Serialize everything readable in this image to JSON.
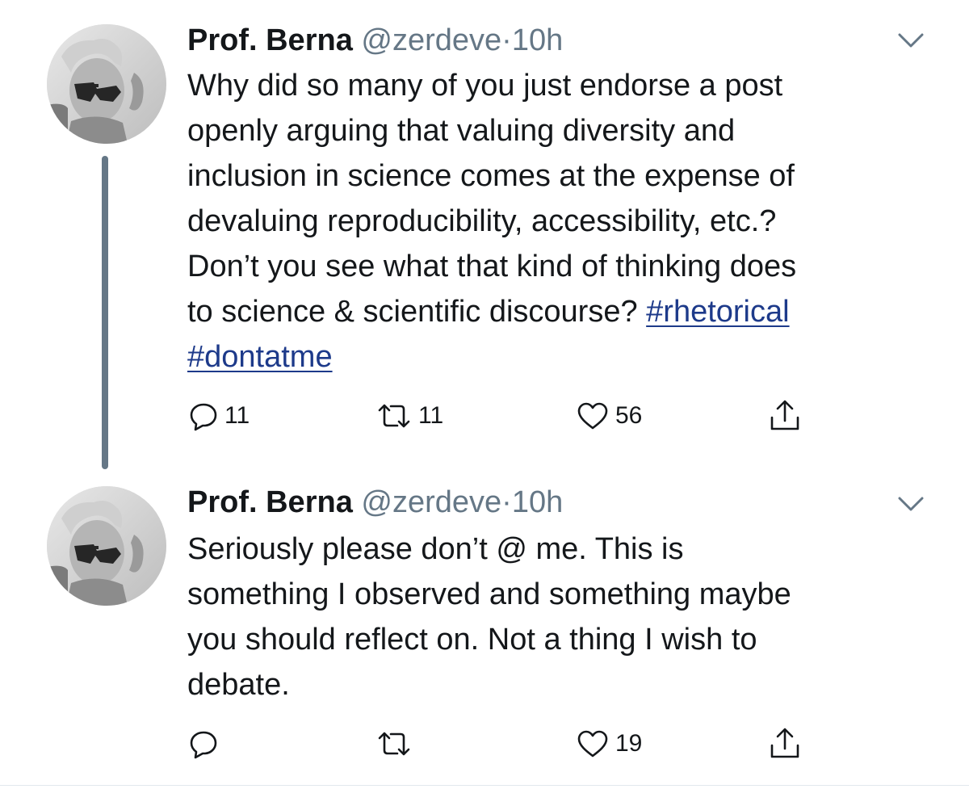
{
  "tweets": [
    {
      "display_name": "Prof. Berna",
      "handle": "@zerdeve",
      "separator": "·",
      "time": "10h",
      "text_lines": [
        "Why did so many of you just endorse a post",
        "openly arguing that valuing diversity and",
        "inclusion in science comes at the expense of",
        "devaluing reproducibility, accessibility, etc.?",
        "Don’t you see what that kind of thinking does",
        "to science & scientific discourse?"
      ],
      "hashtags": [
        "#rhetorical",
        "#dontatme"
      ],
      "reply_count": "11",
      "retweet_count": "11",
      "like_count": "56",
      "icons": {
        "menu": "chevron-down-icon",
        "reply": "reply-icon",
        "retweet": "retweet-icon",
        "like": "heart-icon",
        "share": "share-icon"
      }
    },
    {
      "display_name": "Prof. Berna",
      "handle": "@zerdeve",
      "separator": "·",
      "time": "10h",
      "text_lines": [
        "Seriously please don’t @ me. This is",
        "something I observed and something maybe",
        "you should reflect on. Not a thing I wish to",
        "debate."
      ],
      "reply_count": "",
      "retweet_count": "",
      "like_count": "19",
      "icons": {
        "menu": "chevron-down-icon",
        "reply": "reply-icon",
        "retweet": "retweet-icon",
        "like": "heart-icon",
        "share": "share-icon"
      }
    }
  ],
  "colors": {
    "text": "#14171a",
    "secondary": "#657786",
    "hashtag": "#1d3a8a",
    "thread_line": "#657786"
  }
}
